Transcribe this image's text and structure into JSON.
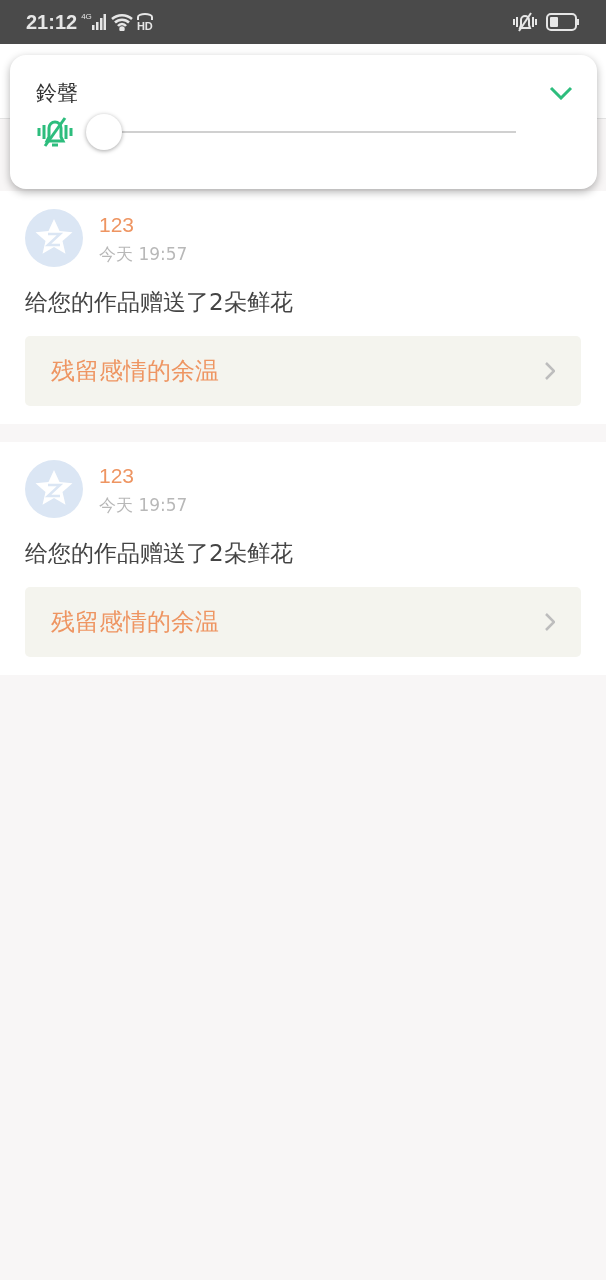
{
  "status_bar": {
    "time": "21:12",
    "network": "4G",
    "call_badge": "HD"
  },
  "volume_panel": {
    "title": "鈴聲",
    "muted": true,
    "level": 0
  },
  "notifications": [
    {
      "user": "123",
      "time": "今天 19:57",
      "message": "给您的作品赠送了2朵鲜花",
      "work_title": "残留感情的余温"
    },
    {
      "user": "123",
      "time": "今天 19:57",
      "message": "给您的作品赠送了2朵鲜花",
      "work_title": "残留感情的余温"
    }
  ]
}
